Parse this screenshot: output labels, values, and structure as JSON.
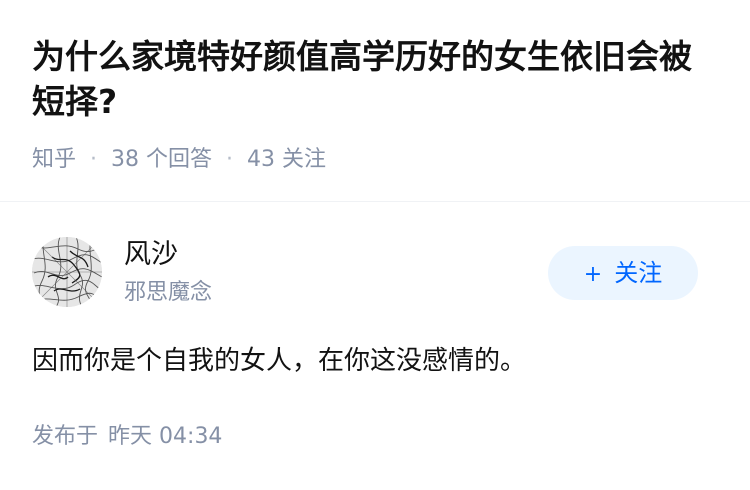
{
  "question": {
    "title": "为什么家境特好颜值高学历好的女生依旧会被短择?",
    "source": "知乎",
    "answer_count": "38",
    "answer_label": "个回答",
    "follow_count": "43",
    "follow_label": "关注"
  },
  "answer": {
    "author": {
      "name": "风沙",
      "headline": "邪思魔念"
    },
    "follow_button": {
      "plus": "+",
      "label": "关注"
    },
    "content": "因而你是个自我的女人，在你这没感情的。",
    "published_prefix": "发布于",
    "published_day": "昨天",
    "published_time": "04:34"
  },
  "colors": {
    "title": "#121212",
    "meta": "#8590a6",
    "accent": "#0066ff",
    "button_bg": "#ebf5ff"
  }
}
